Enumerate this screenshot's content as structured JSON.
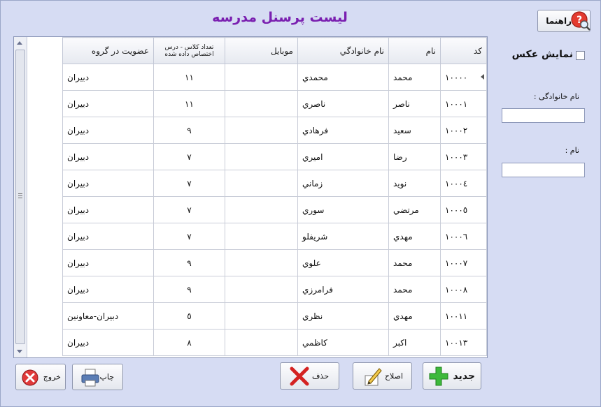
{
  "title": "لیست پرسنل مدرسه",
  "help_button": "راهنما",
  "show_photo": "نمایش عکس",
  "filters": {
    "family_label": "نام خانوادگی :",
    "family_value": "",
    "name_label": "نام :",
    "name_value": ""
  },
  "columns": [
    "کد",
    "نام",
    "نام خانوادگي",
    "موبايل",
    "تعداد كلاس - درس اختصاص داده شده",
    "عضويت در گروه"
  ],
  "rows": [
    [
      "١٠٠٠٠",
      "محمد",
      "محمدي",
      "",
      "١١",
      "دبيران"
    ],
    [
      "١٠٠٠١",
      "ناصر",
      "ناصري",
      "",
      "١١",
      "دبيران"
    ],
    [
      "١٠٠٠٢",
      "سعيد",
      "فرهادي",
      "",
      "٩",
      "دبيران"
    ],
    [
      "١٠٠٠٣",
      "رضا",
      "اميري",
      "",
      "٧",
      "دبيران"
    ],
    [
      "١٠٠٠٤",
      "نويد",
      "زماني",
      "",
      "٧",
      "دبيران"
    ],
    [
      "١٠٠٠٥",
      "مرتضي",
      "سوري",
      "",
      "٧",
      "دبيران"
    ],
    [
      "١٠٠٠٦",
      "مهدي",
      "شريفلو",
      "",
      "٧",
      "دبيران"
    ],
    [
      "١٠٠٠٧",
      "محمد",
      "علوي",
      "",
      "٩",
      "دبيران"
    ],
    [
      "١٠٠٠٨",
      "محمد",
      "فرامرزي",
      "",
      "٩",
      "دبيران"
    ],
    [
      "١٠٠١١",
      "مهدي",
      "نظري",
      "",
      "٥",
      "دبيران-معاونين"
    ],
    [
      "١٠٠١٣",
      "اكبر",
      "كاظمي",
      "",
      "٨",
      "دبيران"
    ]
  ],
  "buttons": {
    "new": "جديد",
    "edit": "اصلاح",
    "delete": "حذف",
    "print": "چاپ",
    "exit": "خروج"
  }
}
